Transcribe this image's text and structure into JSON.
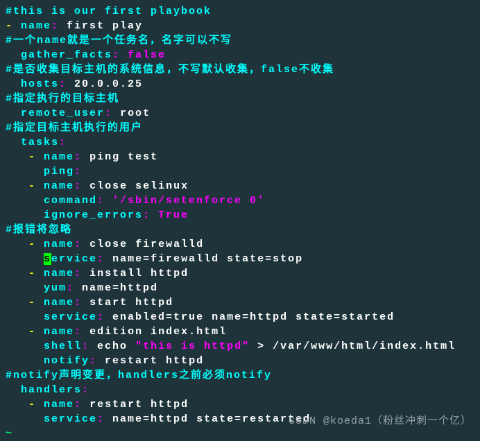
{
  "lines": [
    {
      "segments": [
        {
          "cls": "cyan",
          "t": "#this is our first playbook"
        }
      ]
    },
    {
      "segments": [
        {
          "cls": "yellow",
          "t": "- "
        },
        {
          "cls": "cyan",
          "t": "name"
        },
        {
          "cls": "magenta",
          "t": ": "
        },
        {
          "cls": "white",
          "t": "first play"
        }
      ]
    },
    {
      "segments": [
        {
          "cls": "cyan",
          "t": "#一个name就是一个任务名，名字可以不写"
        }
      ]
    },
    {
      "segments": [
        {
          "cls": "white",
          "t": "  "
        },
        {
          "cls": "cyan",
          "t": "gather_facts"
        },
        {
          "cls": "magenta",
          "t": ": false"
        }
      ]
    },
    {
      "segments": [
        {
          "cls": "cyan",
          "t": "#是否收集目标主机的系统信息，不写默认收集，false不收集"
        }
      ]
    },
    {
      "segments": [
        {
          "cls": "white",
          "t": "  "
        },
        {
          "cls": "cyan",
          "t": "hosts"
        },
        {
          "cls": "magenta",
          "t": ": "
        },
        {
          "cls": "white",
          "t": "20.0.0.25"
        }
      ]
    },
    {
      "segments": [
        {
          "cls": "cyan",
          "t": "#指定执行的目标主机"
        }
      ]
    },
    {
      "segments": [
        {
          "cls": "white",
          "t": "  "
        },
        {
          "cls": "cyan",
          "t": "remote_user"
        },
        {
          "cls": "magenta",
          "t": ": "
        },
        {
          "cls": "white",
          "t": "root"
        }
      ]
    },
    {
      "segments": [
        {
          "cls": "cyan",
          "t": "#指定目标主机执行的用户"
        }
      ]
    },
    {
      "segments": [
        {
          "cls": "white",
          "t": "  "
        },
        {
          "cls": "cyan",
          "t": "tasks"
        },
        {
          "cls": "magenta",
          "t": ":"
        }
      ]
    },
    {
      "segments": [
        {
          "cls": "white",
          "t": "   "
        },
        {
          "cls": "yellow",
          "t": "- "
        },
        {
          "cls": "cyan",
          "t": "name"
        },
        {
          "cls": "magenta",
          "t": ": "
        },
        {
          "cls": "white",
          "t": "ping test"
        }
      ]
    },
    {
      "segments": [
        {
          "cls": "white",
          "t": "     "
        },
        {
          "cls": "cyan",
          "t": "ping"
        },
        {
          "cls": "magenta",
          "t": ":"
        }
      ]
    },
    {
      "segments": [
        {
          "cls": "white",
          "t": "   "
        },
        {
          "cls": "yellow",
          "t": "- "
        },
        {
          "cls": "cyan",
          "t": "name"
        },
        {
          "cls": "magenta",
          "t": ": "
        },
        {
          "cls": "white",
          "t": "close selinux"
        }
      ]
    },
    {
      "segments": [
        {
          "cls": "white",
          "t": "     "
        },
        {
          "cls": "cyan",
          "t": "command"
        },
        {
          "cls": "magenta",
          "t": ": '/sbin/setenforce 0'"
        }
      ]
    },
    {
      "segments": [
        {
          "cls": "white",
          "t": "     "
        },
        {
          "cls": "cyan",
          "t": "ignore_errors"
        },
        {
          "cls": "magenta",
          "t": ": True"
        }
      ]
    },
    {
      "segments": [
        {
          "cls": "cyan",
          "t": "#报错将忽略"
        }
      ]
    },
    {
      "segments": [
        {
          "cls": "white",
          "t": "   "
        },
        {
          "cls": "yellow",
          "t": "- "
        },
        {
          "cls": "cyan",
          "t": "name"
        },
        {
          "cls": "magenta",
          "t": ": "
        },
        {
          "cls": "white",
          "t": "close firewalld"
        }
      ]
    },
    {
      "segments": [
        {
          "cls": "white",
          "t": "     "
        },
        {
          "cls": "green-cursor",
          "t": "s"
        },
        {
          "cls": "cyan",
          "t": "ervice"
        },
        {
          "cls": "magenta",
          "t": ": "
        },
        {
          "cls": "white",
          "t": "name=firewalld state=stop"
        }
      ]
    },
    {
      "segments": [
        {
          "cls": "white",
          "t": "   "
        },
        {
          "cls": "yellow",
          "t": "- "
        },
        {
          "cls": "cyan",
          "t": "name"
        },
        {
          "cls": "magenta",
          "t": ": "
        },
        {
          "cls": "white",
          "t": "install httpd"
        }
      ]
    },
    {
      "segments": [
        {
          "cls": "white",
          "t": "     "
        },
        {
          "cls": "cyan",
          "t": "yum"
        },
        {
          "cls": "magenta",
          "t": ": "
        },
        {
          "cls": "white",
          "t": "name=httpd"
        }
      ]
    },
    {
      "segments": [
        {
          "cls": "white",
          "t": "   "
        },
        {
          "cls": "yellow",
          "t": "- "
        },
        {
          "cls": "cyan",
          "t": "name"
        },
        {
          "cls": "magenta",
          "t": ": "
        },
        {
          "cls": "white",
          "t": "start httpd"
        }
      ]
    },
    {
      "segments": [
        {
          "cls": "white",
          "t": "     "
        },
        {
          "cls": "cyan",
          "t": "service"
        },
        {
          "cls": "magenta",
          "t": ": "
        },
        {
          "cls": "white",
          "t": "enabled=true name=httpd state=started"
        }
      ]
    },
    {
      "segments": [
        {
          "cls": "white",
          "t": "   "
        },
        {
          "cls": "yellow",
          "t": "- "
        },
        {
          "cls": "cyan",
          "t": "name"
        },
        {
          "cls": "magenta",
          "t": ": "
        },
        {
          "cls": "white",
          "t": "edition index.html"
        }
      ]
    },
    {
      "segments": [
        {
          "cls": "white",
          "t": "     "
        },
        {
          "cls": "cyan",
          "t": "shell"
        },
        {
          "cls": "magenta",
          "t": ": "
        },
        {
          "cls": "white",
          "t": "echo "
        },
        {
          "cls": "magenta",
          "t": "\"this is httpd\""
        },
        {
          "cls": "white",
          "t": " > /var/www/html/index.html"
        }
      ]
    },
    {
      "segments": [
        {
          "cls": "white",
          "t": "     "
        },
        {
          "cls": "cyan",
          "t": "notify"
        },
        {
          "cls": "magenta",
          "t": ": "
        },
        {
          "cls": "white",
          "t": "restart httpd"
        }
      ]
    },
    {
      "segments": [
        {
          "cls": "cyan",
          "t": "#notify声明变更，handlers之前必须notify"
        }
      ]
    },
    {
      "segments": [
        {
          "cls": "white",
          "t": "  "
        },
        {
          "cls": "cyan",
          "t": "handlers"
        },
        {
          "cls": "magenta",
          "t": ":"
        }
      ]
    },
    {
      "segments": [
        {
          "cls": "white",
          "t": "   "
        },
        {
          "cls": "yellow",
          "t": "- "
        },
        {
          "cls": "cyan",
          "t": "name"
        },
        {
          "cls": "magenta",
          "t": ": "
        },
        {
          "cls": "white",
          "t": "restart httpd"
        }
      ]
    },
    {
      "segments": [
        {
          "cls": "white",
          "t": "     "
        },
        {
          "cls": "cyan",
          "t": "service"
        },
        {
          "cls": "magenta",
          "t": ": "
        },
        {
          "cls": "white",
          "t": "name=httpd state=restarted"
        }
      ]
    },
    {
      "segments": [
        {
          "cls": "tilde",
          "t": "~"
        }
      ]
    }
  ],
  "watermark": "CSDN @koeda1（粉丝冲刺一个亿）"
}
